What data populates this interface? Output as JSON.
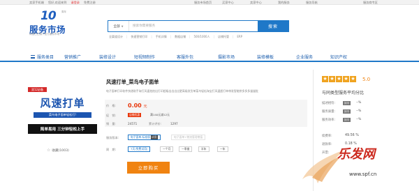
{
  "topbar": {
    "links": [
      "卖家手机端",
      "您好,欢迎来到",
      "请登录",
      "免费注册"
    ],
    "right": [
      "服务市场首页",
      "买家中心",
      "卖家中心",
      "我的服务",
      "服务导航",
      "服务商专区"
    ]
  },
  "logo": {
    "badge": "10",
    "tm": "周年",
    "name": "服务市场",
    "slogan": "阿里巴巴旗下官方服务市场"
  },
  "search": {
    "scope": "全部",
    "placeholder": "搜索你需要服务",
    "button": "搜索",
    "hot_words": [
      "全渠道设计",
      "快速营销打印",
      "手机详情",
      "数据店铺",
      "500/1000人",
      "店铺托管",
      "ERP"
    ]
  },
  "nav": {
    "all_label": "服务类目",
    "items": [
      "营销推广",
      "装修设计",
      "短视频制作",
      "客服外包",
      "摄影市场",
      "装修模板",
      "企业服务",
      "知识产权"
    ]
  },
  "product": {
    "image": {
      "tag": "双12必备",
      "big": "风速打单",
      "sub": "菜鸟电子面单轻松打!",
      "bottom": "简单易用 三分钟轻松上手"
    },
    "favorites": "收藏(1003)",
    "title": "风速打单_菜鸟电子面单",
    "desc": "电子面单打印软件快递助手淘打风速拍拍出打印超级出出出出更高级发货单菜鸟轻松淘宝打风速超打单带发智能拼多多多量量批",
    "price_label": "价　格:",
    "price": "0.00",
    "price_unit": "元",
    "promo_label": "促　销:",
    "promo_badge": "店铺优惠",
    "promo_text": "满140元减12元",
    "sales_label": "销　量:",
    "sales": "24571",
    "cumulative_label": "累计评价:",
    "cumulative": "1297",
    "version_label": "服务版本:",
    "versions": [
      {
        "label": "电子面单-标准版",
        "hl": "试用",
        "selected": true
      },
      {
        "label": "电子面单+物流管理增值",
        "hl": "",
        "selected": false
      }
    ],
    "period_label": "周　期:",
    "periods": [
      "7天(免费试用)",
      "一个月",
      "一季度",
      "半年",
      "一年"
    ],
    "buy": "立即购买"
  },
  "rating": {
    "score": "5.0",
    "compare_title": "与同类型服务平均分比",
    "rows": [
      {
        "label": "描述相符:",
        "badge": "持平",
        "val": "--%"
      },
      {
        "label": "服务质量:",
        "badge": "持平",
        "val": "--%"
      },
      {
        "label": "服务效率:",
        "badge": "持平",
        "val": "--%"
      }
    ],
    "extra": [
      {
        "label": "续费率:",
        "val": "49.56 %"
      },
      {
        "label": "退款率:",
        "val": "0.18 %"
      },
      {
        "label": "开票:",
        "val": ""
      }
    ]
  },
  "watermark": {
    "text": "乐发网",
    "url": "www.spf.cn"
  },
  "colors": {
    "brand_blue": "#1f78c8",
    "price_red": "#e8380d",
    "buy_orange": "#f08311",
    "star_orange": "#f0a31f"
  }
}
